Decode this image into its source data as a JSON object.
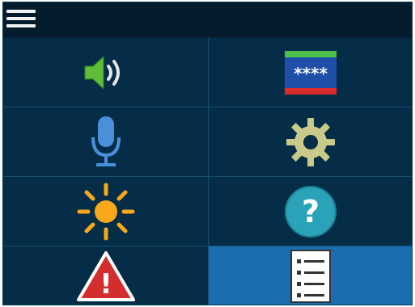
{
  "header": {
    "menu_icon": "hamburger-menu-icon"
  },
  "tiles": [
    {
      "name": "volume",
      "icon": "speaker-volume-icon"
    },
    {
      "name": "password",
      "icon": "password-field-icon",
      "text": "****"
    },
    {
      "name": "microphone",
      "icon": "microphone-icon"
    },
    {
      "name": "settings",
      "icon": "gear-icon"
    },
    {
      "name": "brightness",
      "icon": "sun-brightness-icon"
    },
    {
      "name": "help",
      "icon": "question-help-icon",
      "text": "?"
    },
    {
      "name": "warning",
      "icon": "warning-alert-icon",
      "text": "!"
    },
    {
      "name": "list",
      "icon": "list-document-icon",
      "active": true
    }
  ],
  "colors": {
    "background": "#052d47",
    "active_tile": "#1a6eb0",
    "grid_line": "#14506f"
  }
}
